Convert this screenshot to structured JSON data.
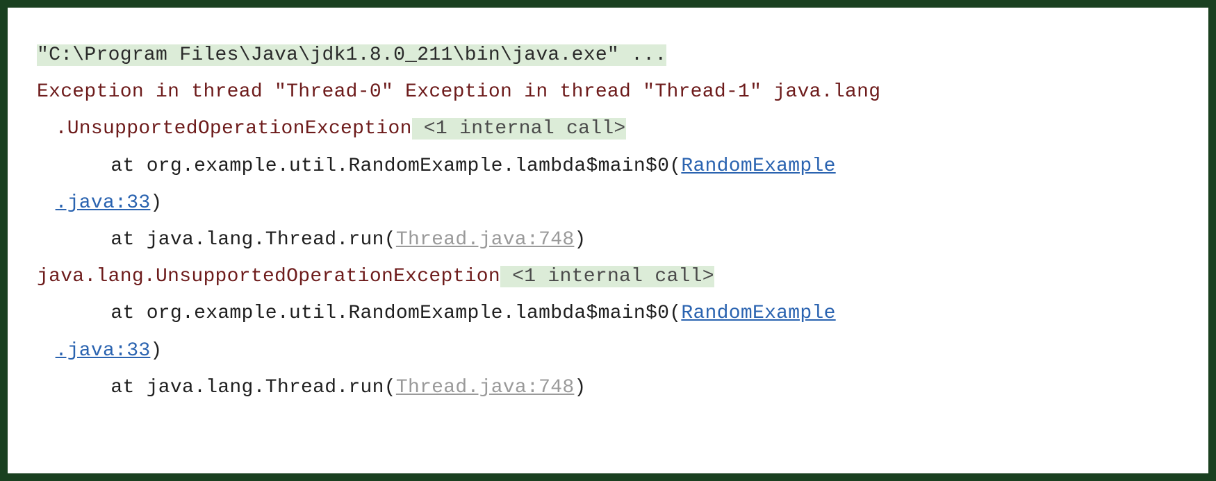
{
  "console": {
    "command": "\"C:\\Program Files\\Java\\jdk1.8.0_211\\bin\\java.exe\" ...",
    "exception_header_a": "Exception in thread \"Thread-0\" Exception in thread \"Thread-1\" java.lang",
    "exception_header_b": ".UnsupportedOperationException",
    "folded_call": " <1 internal call>",
    "at_prefix": "at ",
    "frame1_method": "org.example.util.RandomExample.lambda$main$0",
    "paren_open": "(",
    "paren_close": ")",
    "frame1_link_a": "RandomExample",
    "frame1_link_b": ".java:33",
    "frame2_method": "java.lang.Thread.run",
    "frame2_link": "Thread.java:748",
    "second_exception": "java.lang.UnsupportedOperationException",
    "second_folded": " <1 internal call>",
    "frame3_method": "org.example.util.RandomExample.lambda$main$0",
    "frame3_link_a": "RandomExample",
    "frame3_link_b": ".java:33",
    "frame4_method": "java.lang.Thread.run",
    "frame4_link": "Thread.java:748"
  }
}
